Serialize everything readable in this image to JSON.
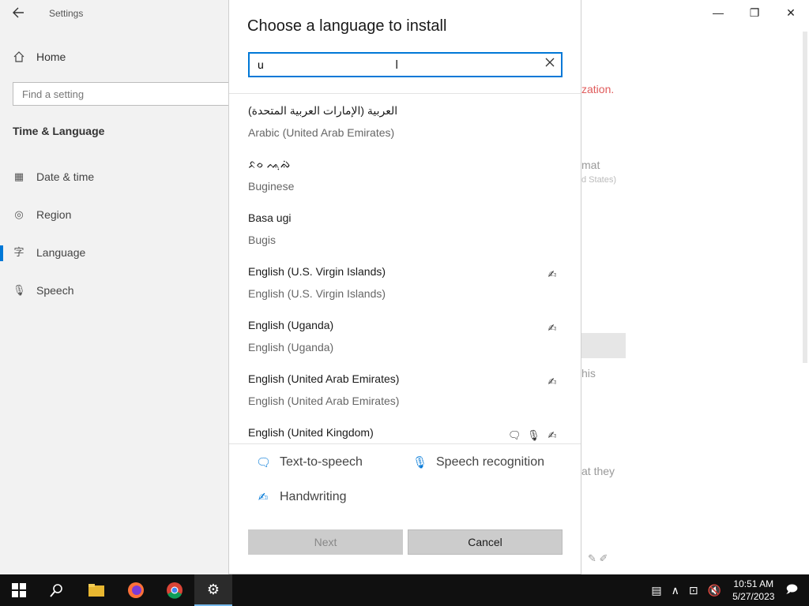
{
  "settings": {
    "title": "Settings",
    "home": "Home",
    "find_placeholder": "Find a setting",
    "section": "Time & Language",
    "nav": [
      {
        "label": "Date & time"
      },
      {
        "label": "Region"
      },
      {
        "label": "Language"
      },
      {
        "label": "Speech"
      }
    ],
    "bg_fragments": {
      "red": "zation.",
      "format": "mat",
      "states": "d States)",
      "this": "his",
      "they": "at they"
    }
  },
  "dialog": {
    "title": "Choose a language to install",
    "search_value": "u",
    "languages": [
      {
        "native": "العربية (الإمارات العربية المتحدة)",
        "english": "Arabic (United Arab Emirates)",
        "features": []
      },
      {
        "native": "ᨅᨔ ᨕᨘᨁᨗ",
        "english": "Buginese",
        "features": []
      },
      {
        "native": "Basa ugi",
        "english": "Bugis",
        "features": []
      },
      {
        "native": "English (U.S. Virgin Islands)",
        "english": "English (U.S. Virgin Islands)",
        "features": [
          "handwriting"
        ]
      },
      {
        "native": "English (Uganda)",
        "english": "English (Uganda)",
        "features": [
          "handwriting"
        ]
      },
      {
        "native": "English (United Arab Emirates)",
        "english": "English (United Arab Emirates)",
        "features": [
          "handwriting"
        ]
      },
      {
        "native": "English (United Kingdom)",
        "english": "",
        "features": [
          "text-to-speech",
          "speech-recognition",
          "handwriting"
        ]
      }
    ],
    "legend": {
      "tts": "Text-to-speech",
      "speech": "Speech recognition",
      "handwriting": "Handwriting"
    },
    "next_label": "Next",
    "cancel_label": "Cancel"
  },
  "taskbar": {
    "time": "10:51 AM",
    "date": "5/27/2023"
  }
}
